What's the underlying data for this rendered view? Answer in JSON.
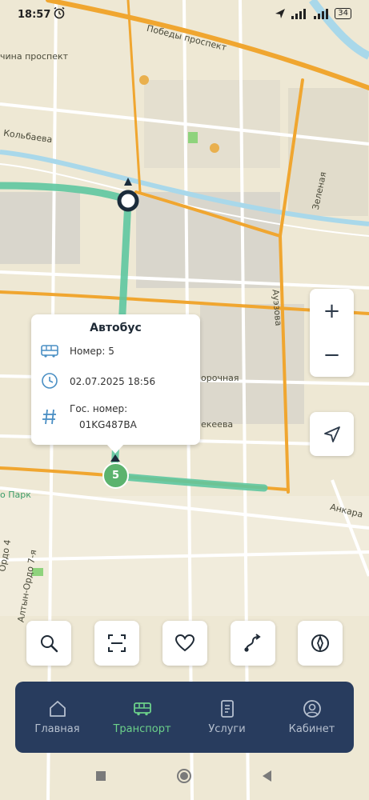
{
  "status": {
    "time": "18:57",
    "battery": "34"
  },
  "map": {
    "labels": [
      {
        "id": "pobedy",
        "text": "Победы проспект"
      },
      {
        "id": "chuy",
        "text": "чина проспект"
      },
      {
        "id": "kolbaeva",
        "text": "Кольбаева"
      },
      {
        "id": "zelenaya",
        "text": "Зеленая"
      },
      {
        "id": "auezova",
        "text": "Ауэзова"
      },
      {
        "id": "ozernaya",
        "text": "орочная"
      },
      {
        "id": "ekeeva",
        "text": "екеева"
      },
      {
        "id": "park",
        "text": "о Парк"
      },
      {
        "id": "ankara",
        "text": "Анкара"
      },
      {
        "id": "altyn",
        "text": "Алтын-Ордо 7-я"
      },
      {
        "id": "odo",
        "text": "Ордо 4"
      }
    ]
  },
  "popup": {
    "title": "Автобус",
    "number": "Номер: 5",
    "datetime": "02.07.2025 18:56",
    "plate_label": "Гос. номер:",
    "plate": "01KG487BA"
  },
  "bus_marker": {
    "route": "5"
  },
  "zoom": {
    "in": "+",
    "out": "−"
  },
  "toolbar": [
    "search-icon",
    "scan-icon",
    "heart-icon",
    "route-icon",
    "compass-icon"
  ],
  "nav": {
    "home": "Главная",
    "transport": "Транспорт",
    "services": "Услуги",
    "cabinet": "Кабинет"
  },
  "colors": {
    "accent": "#6cd18a",
    "navbar": "#283c5e",
    "route": "#5ec7a0",
    "road": "#f0a630"
  }
}
